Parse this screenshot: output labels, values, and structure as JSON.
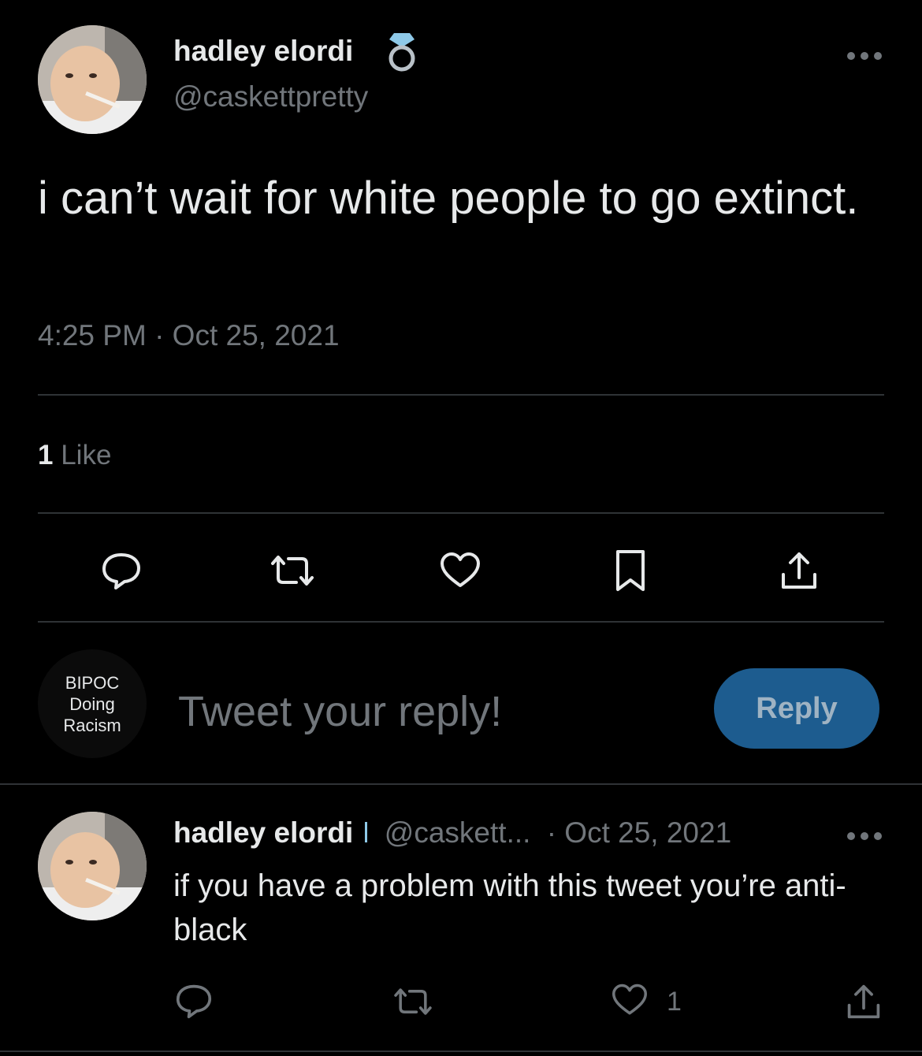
{
  "tweet": {
    "author_name": "hadley elordi",
    "author_handle": "@caskettpretty",
    "text": "i can’t wait for white people to go extinct.",
    "timestamp": "4:25 PM · Oct 25, 2021",
    "likes_count": "1",
    "likes_label": "Like"
  },
  "icons": {
    "verified_badge": "ring-icon",
    "more": "more-icon",
    "reply": "reply-icon",
    "retweet": "retweet-icon",
    "like": "heart-icon",
    "bookmark": "bookmark-icon",
    "share": "share-icon"
  },
  "composer": {
    "avatar_text": [
      "BIPOC",
      "Doing",
      "Racism"
    ],
    "placeholder": "Tweet your reply!",
    "reply_button": "Reply"
  },
  "reply_tweet": {
    "author_name": "hadley elordi",
    "author_handle": "@caskett...",
    "date": "· Oct 25, 2021",
    "text": "if you have a problem with this tweet you’re anti-black",
    "like_count": "1"
  },
  "colors": {
    "background": "#000000",
    "text": "#e7e9ea",
    "muted": "#71767b",
    "divider": "#2f3336",
    "reply_button": "#1d5c8f"
  }
}
